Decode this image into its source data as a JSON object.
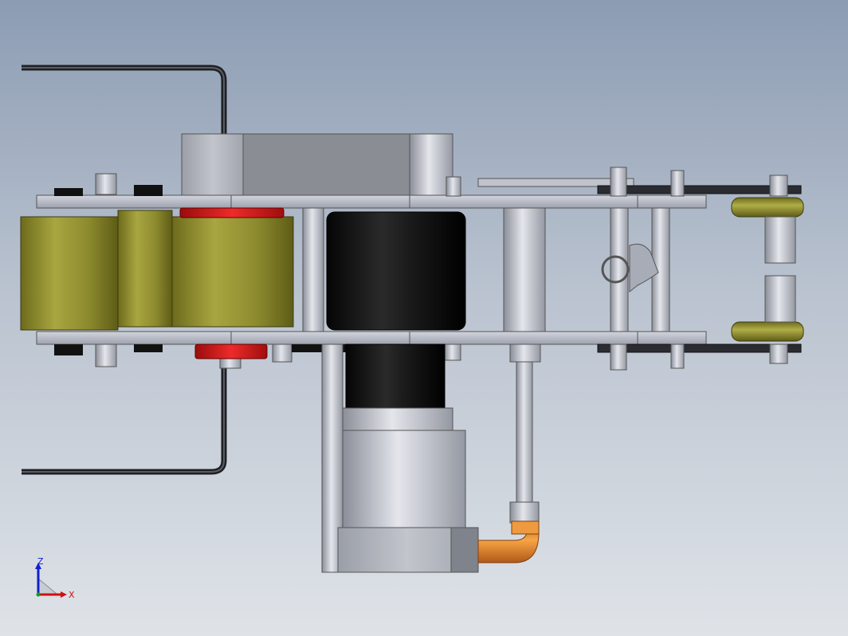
{
  "viewport": {
    "colors": {
      "bg_top": "#8c9cb3",
      "bg_bottom": "#dfe3e8",
      "roller_olive": "#9c9a3a",
      "roller_red": "#d01818",
      "motor_black": "#0c0c0c",
      "frame_silver": "#b8bcc8",
      "elbow_orange": "#e08a2a",
      "axis_x": "#d01010",
      "axis_y": "#10a010",
      "axis_z": "#1020d0"
    }
  },
  "triad": {
    "z_label": "Z",
    "x_label": "X"
  }
}
